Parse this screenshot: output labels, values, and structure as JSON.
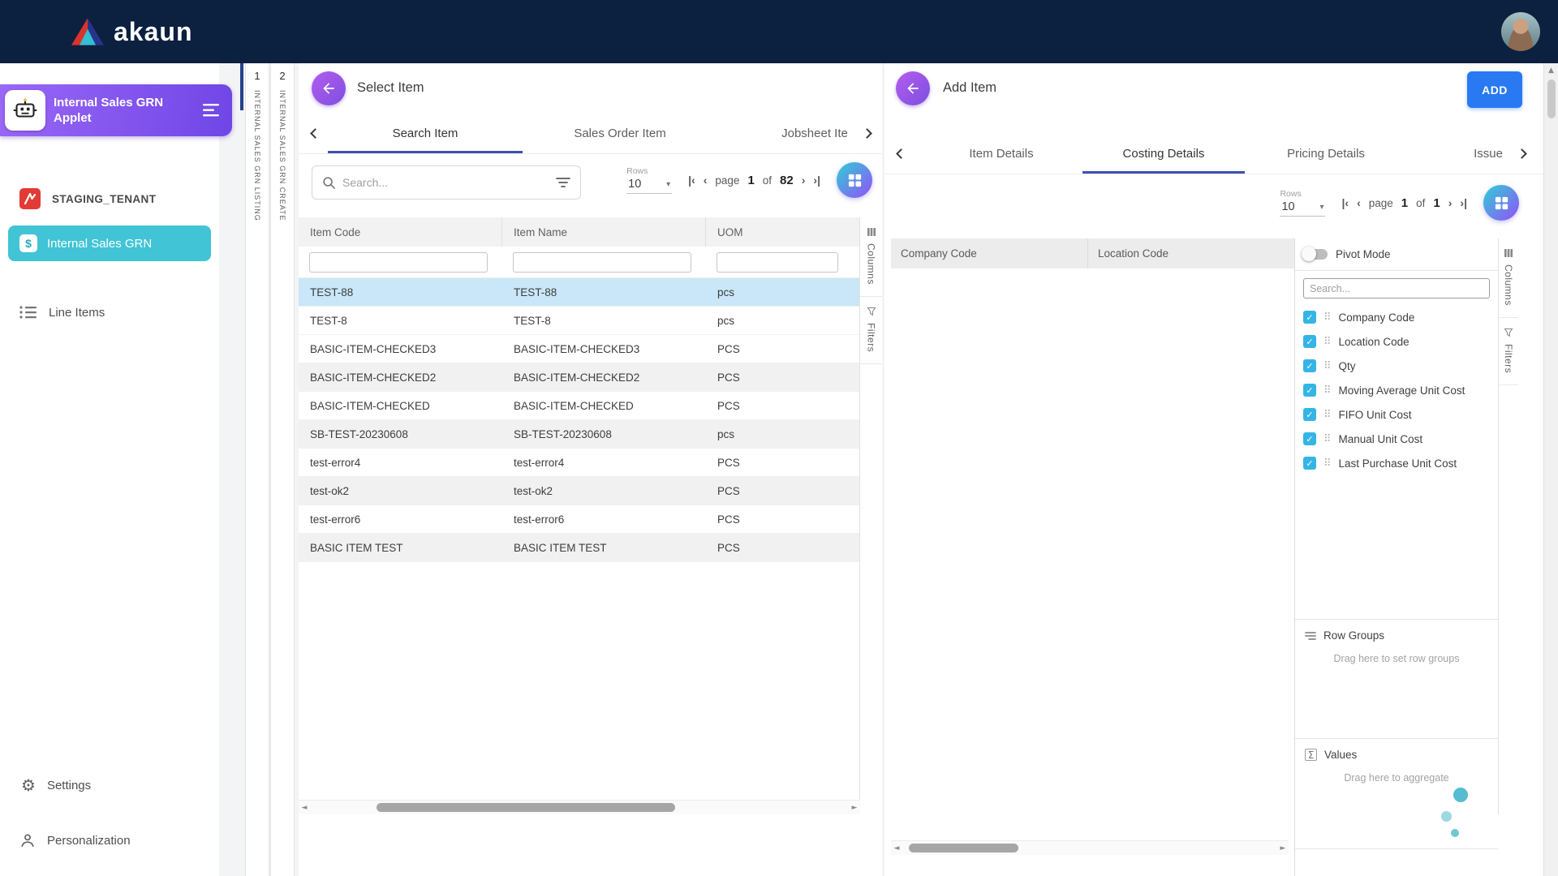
{
  "header": {
    "brand": "akaun"
  },
  "sidebar": {
    "applet_title": "Internal Sales GRN Applet",
    "tenant": "STAGING_TENANT",
    "module": "Internal Sales GRN",
    "nav": [
      {
        "label": "Line Items"
      }
    ],
    "footer": [
      {
        "label": "Settings"
      },
      {
        "label": "Personalization"
      }
    ]
  },
  "rail": {
    "steps": [
      {
        "num": "1",
        "label": "INTERNAL SALES GRN LISTING"
      },
      {
        "num": "2",
        "label": "INTERNAL SALES GRN CREATE"
      }
    ]
  },
  "select_item": {
    "title": "Select Item",
    "tabs": [
      {
        "label": "Search Item",
        "active": true
      },
      {
        "label": "Sales Order Item",
        "active": false
      },
      {
        "label": "Jobsheet Ite",
        "active": false
      }
    ],
    "search_placeholder": "Search...",
    "rows_label": "Rows",
    "rows_value": "10",
    "pagination": {
      "page_word": "page",
      "page": "1",
      "of_word": "of",
      "total": "82"
    },
    "columns": [
      "Item Code",
      "Item Name",
      "UOM"
    ],
    "rows": [
      {
        "cells": [
          "TEST-88",
          "TEST-88",
          "pcs"
        ],
        "selected": true
      },
      {
        "cells": [
          "TEST-8",
          "TEST-8",
          "pcs"
        ],
        "selected": false
      },
      {
        "cells": [
          "BASIC-ITEM-CHECKED3",
          "BASIC-ITEM-CHECKED3",
          "PCS"
        ],
        "selected": false
      },
      {
        "cells": [
          "BASIC-ITEM-CHECKED2",
          "BASIC-ITEM-CHECKED2",
          "PCS"
        ],
        "selected": false
      },
      {
        "cells": [
          "BASIC-ITEM-CHECKED",
          "BASIC-ITEM-CHECKED",
          "PCS"
        ],
        "selected": false
      },
      {
        "cells": [
          "SB-TEST-20230608",
          "SB-TEST-20230608",
          "pcs"
        ],
        "selected": false
      },
      {
        "cells": [
          "test-error4",
          "test-error4",
          "PCS"
        ],
        "selected": false
      },
      {
        "cells": [
          "test-ok2",
          "test-ok2",
          "PCS"
        ],
        "selected": false
      },
      {
        "cells": [
          "test-error6",
          "test-error6",
          "PCS"
        ],
        "selected": false
      },
      {
        "cells": [
          "BASIC ITEM TEST",
          "BASIC ITEM TEST",
          "PCS"
        ],
        "selected": false
      }
    ],
    "side_tabs": [
      {
        "label": "Columns"
      },
      {
        "label": "Filters"
      }
    ]
  },
  "add_item": {
    "title": "Add Item",
    "add_button": "ADD",
    "tabs": [
      {
        "label": "Item Details",
        "active": false
      },
      {
        "label": "Costing Details",
        "active": true
      },
      {
        "label": "Pricing Details",
        "active": false
      },
      {
        "label": "Issue",
        "active": false
      }
    ],
    "rows_label": "Rows",
    "rows_value": "10",
    "pagination": {
      "page_word": "page",
      "page": "1",
      "of_word": "of",
      "total": "1"
    },
    "columns": [
      "Company Code",
      "Location Code"
    ],
    "tool_panel": {
      "pivot_label": "Pivot Mode",
      "search_placeholder": "Search...",
      "fields": [
        "Company Code",
        "Location Code",
        "Qty",
        "Moving Average Unit Cost",
        "FIFO Unit Cost",
        "Manual Unit Cost",
        "Last Purchase Unit Cost"
      ],
      "row_groups_title": "Row Groups",
      "row_groups_hint": "Drag here to set row groups",
      "values_title": "Values",
      "values_hint": "Drag here to aggregate"
    },
    "side_tabs": [
      {
        "label": "Columns"
      },
      {
        "label": "Filters"
      }
    ]
  },
  "icons": {
    "check": "✓",
    "drag": "⠿",
    "caret": "▾",
    "sigma": "Σ",
    "pg_first": "|‹",
    "pg_prev": "‹",
    "pg_next": "›",
    "pg_last": "›|",
    "scroll_left": "◄",
    "scroll_right": "►",
    "scroll_up": "▲",
    "gear": "⚙"
  },
  "colors": {
    "header_bg": "#0c2040",
    "accent_purple": "#7b4fe0",
    "accent_teal": "#41c4d5",
    "add_blue": "#2979f2",
    "tab_underline": "#3f51b5",
    "selected_row": "#c9e7f8",
    "checkbox": "#35b5e5"
  }
}
